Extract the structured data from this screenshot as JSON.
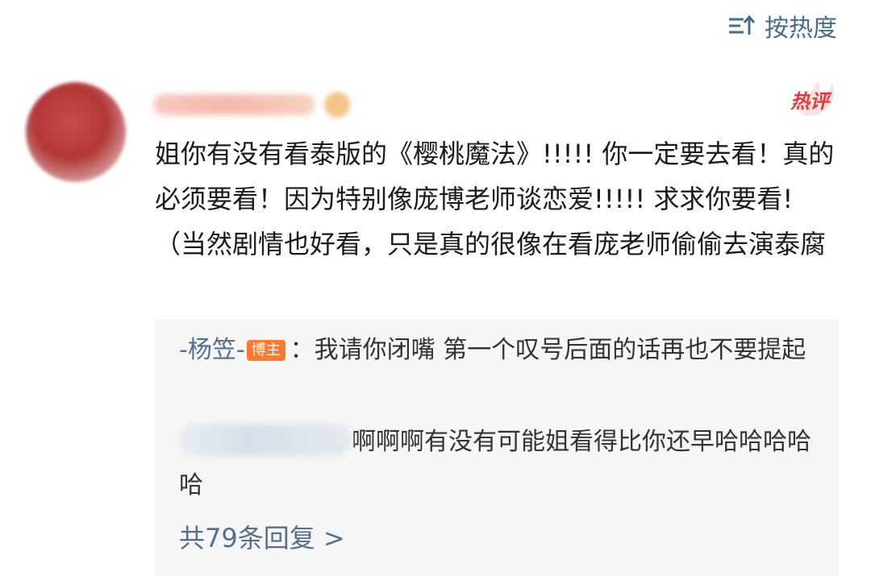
{
  "sort": {
    "label": "按热度",
    "icon": "sort-icon"
  },
  "comment": {
    "avatar_icon": "avatar",
    "hot_label": "热评",
    "text": "姐你有没有看泰版的《樱桃魔法》!!!!! 你一定要去看！真的必须要看！因为特别像庞博老师谈恋爱!!!!! 求求你要看!（当然剧情也好看，只是真的很像在看庞老师偷偷去演泰腐"
  },
  "replies": [
    {
      "author": "-杨笠-",
      "badge": "博主",
      "separator": "：",
      "text": "我请你闭嘴 第一个叹号后面的话再也不要提起"
    },
    {
      "text": "啊啊啊有没有可能姐看得比你还早哈哈哈哈哈"
    }
  ],
  "view_all_label": "共79条回复 >",
  "colors": {
    "link": "#55708f",
    "hot": "#e4393c",
    "badge": "#ff7a2e",
    "reply_bg": "#f6f6f6"
  }
}
